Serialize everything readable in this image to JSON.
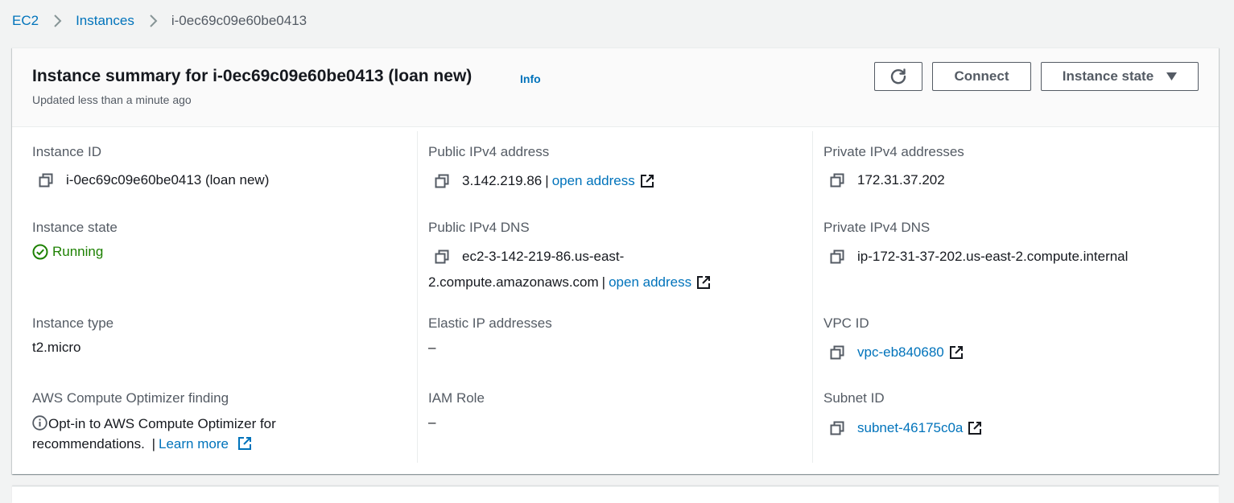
{
  "breadcrumb": {
    "root": "EC2",
    "instances": "Instances",
    "current": "i-0ec69c09e60be0413"
  },
  "header": {
    "title": "Instance summary for i-0ec69c09e60be0413 (loan new)",
    "info": "Info",
    "subtitle": "Updated less than a minute ago",
    "refresh_icon": "refresh-icon",
    "connect_label": "Connect",
    "instance_state_label": "Instance state"
  },
  "fields": {
    "instance_id": {
      "label": "Instance ID",
      "value": "i-0ec69c09e60be0413 (loan new)"
    },
    "public_ipv4": {
      "label": "Public IPv4 address",
      "value": "3.142.219.86",
      "sep": "|",
      "link": "open address"
    },
    "private_ipv4": {
      "label": "Private IPv4 addresses",
      "value": "172.31.37.202"
    },
    "instance_state": {
      "label": "Instance state",
      "value": "Running",
      "color": "#1d8102"
    },
    "public_dns": {
      "label": "Public IPv4 DNS",
      "value_line1": "ec2-3-142-219-86.us-east-",
      "value_line2": "2.compute.amazonaws.com",
      "sep": "|",
      "link": "open address"
    },
    "private_dns": {
      "label": "Private IPv4 DNS",
      "value": "ip-172-31-37-202.us-east-2.compute.internal"
    },
    "instance_type": {
      "label": "Instance type",
      "value": "t2.micro"
    },
    "elastic_ip": {
      "label": "Elastic IP addresses",
      "value": "–"
    },
    "vpc_id": {
      "label": "VPC ID",
      "value": "vpc-eb840680"
    },
    "optimizer": {
      "label": "AWS Compute Optimizer finding",
      "text_line1": "Opt-in to AWS Compute Optimizer for",
      "text_line2": "recommendations.",
      "sep": "|",
      "link": "Learn more"
    },
    "iam_role": {
      "label": "IAM Role",
      "value": "–"
    },
    "subnet_id": {
      "label": "Subnet ID",
      "value": "subnet-46175c0a"
    }
  },
  "colors": {
    "link": "#0073bb",
    "running": "#1d8102",
    "label": "#545b64",
    "background": "#f2f3f3"
  }
}
